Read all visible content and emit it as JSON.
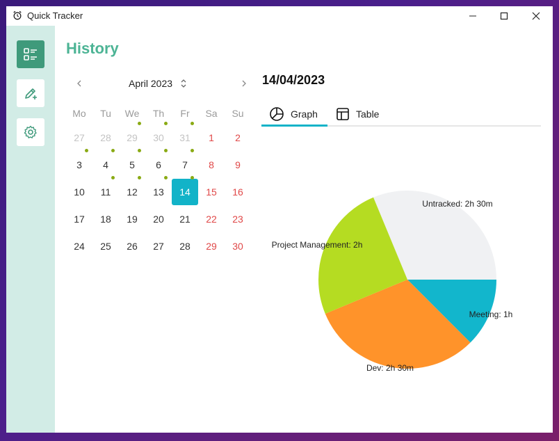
{
  "window": {
    "title": "Quick Tracker"
  },
  "page": {
    "title": "History"
  },
  "calendar": {
    "month_label": "April 2023",
    "weekdays": [
      "Mo",
      "Tu",
      "We",
      "Th",
      "Fr",
      "Sa",
      "Su"
    ],
    "weeks": [
      [
        {
          "d": "27",
          "t": "other"
        },
        {
          "d": "28",
          "t": "other"
        },
        {
          "d": "29",
          "t": "other",
          "dot": true
        },
        {
          "d": "30",
          "t": "other",
          "dot": true
        },
        {
          "d": "31",
          "t": "other",
          "dot": true
        },
        {
          "d": "1",
          "t": "weekend"
        },
        {
          "d": "2",
          "t": "weekend"
        }
      ],
      [
        {
          "d": "3",
          "t": "weekday-day",
          "dot": true
        },
        {
          "d": "4",
          "t": "weekday-day",
          "dot": true
        },
        {
          "d": "5",
          "t": "weekday-day",
          "dot": true
        },
        {
          "d": "6",
          "t": "weekday-day",
          "dot": true
        },
        {
          "d": "7",
          "t": "weekday-day",
          "dot": true
        },
        {
          "d": "8",
          "t": "weekend"
        },
        {
          "d": "9",
          "t": "weekend"
        }
      ],
      [
        {
          "d": "10",
          "t": "weekday-day"
        },
        {
          "d": "11",
          "t": "weekday-day",
          "dot": true
        },
        {
          "d": "12",
          "t": "weekday-day",
          "dot": true
        },
        {
          "d": "13",
          "t": "weekday-day",
          "dot": true
        },
        {
          "d": "14",
          "t": "selected",
          "dot": true
        },
        {
          "d": "15",
          "t": "weekend"
        },
        {
          "d": "16",
          "t": "weekend"
        }
      ],
      [
        {
          "d": "17",
          "t": "weekday-day"
        },
        {
          "d": "18",
          "t": "weekday-day"
        },
        {
          "d": "19",
          "t": "weekday-day"
        },
        {
          "d": "20",
          "t": "weekday-day"
        },
        {
          "d": "21",
          "t": "weekday-day"
        },
        {
          "d": "22",
          "t": "weekend"
        },
        {
          "d": "23",
          "t": "weekend"
        }
      ],
      [
        {
          "d": "24",
          "t": "weekday-day"
        },
        {
          "d": "25",
          "t": "weekday-day"
        },
        {
          "d": "26",
          "t": "weekday-day"
        },
        {
          "d": "27",
          "t": "weekday-day"
        },
        {
          "d": "28",
          "t": "weekday-day"
        },
        {
          "d": "29",
          "t": "weekend"
        },
        {
          "d": "30",
          "t": "weekend"
        }
      ]
    ]
  },
  "detail": {
    "date": "14/04/2023",
    "tabs": [
      {
        "label": "Graph",
        "icon": "pie-chart-icon",
        "active": true
      },
      {
        "label": "Table",
        "icon": "table-icon",
        "active": false
      }
    ]
  },
  "colors": {
    "accent": "#12b3c8",
    "brand": "#4db495",
    "sidebar_active": "#3f9a7b",
    "weekend": "#e04848",
    "dot": "#8aaa14"
  },
  "chart_data": {
    "type": "pie",
    "slices": [
      {
        "label": "Untracked: 2h 30m",
        "value": 150,
        "color": "#f0f1f3"
      },
      {
        "label": "Meeting: 1h",
        "value": 60,
        "color": "#12b6cc"
      },
      {
        "label": "Dev: 2h 30m",
        "value": 150,
        "color": "#ff932a"
      },
      {
        "label": "Project Management: 2h",
        "value": 120,
        "color": "#b5dc22"
      }
    ]
  }
}
